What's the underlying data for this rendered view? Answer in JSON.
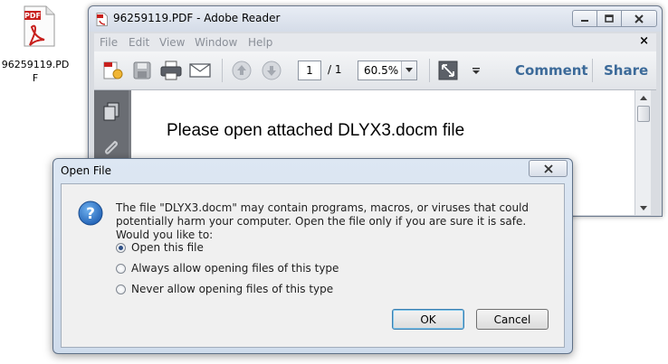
{
  "desktop": {
    "icon": "pdf-file-icon",
    "icon_badge": "PDF",
    "file_label": "96259119.PDF"
  },
  "reader": {
    "title": "96259119.PDF - Adobe Reader",
    "menu": [
      "File",
      "Edit",
      "View",
      "Window",
      "Help"
    ],
    "toolbar": {
      "page_current": "1",
      "page_total": "/ 1",
      "zoom": "60.5%",
      "comment_label": "Comment",
      "share_label": "Share"
    },
    "document_text": "Please open attached DLYX3.docm file"
  },
  "dialog": {
    "title": "Open File",
    "message": "The file \"DLYX3.docm\" may contain programs, macros, or viruses that could potentially harm your computer. Open the file only if you are sure it is safe. Would you like to:",
    "options": [
      {
        "label": "Open this file",
        "checked": true
      },
      {
        "label": "Always allow opening files of this type",
        "checked": false
      },
      {
        "label": "Never allow opening files of this type",
        "checked": false
      }
    ],
    "ok_label": "OK",
    "cancel_label": "Cancel"
  },
  "colors": {
    "toolbar_link": "#3c6a99",
    "dialog_frame": "#cfdcec",
    "pdf_red": "#c8201d"
  }
}
